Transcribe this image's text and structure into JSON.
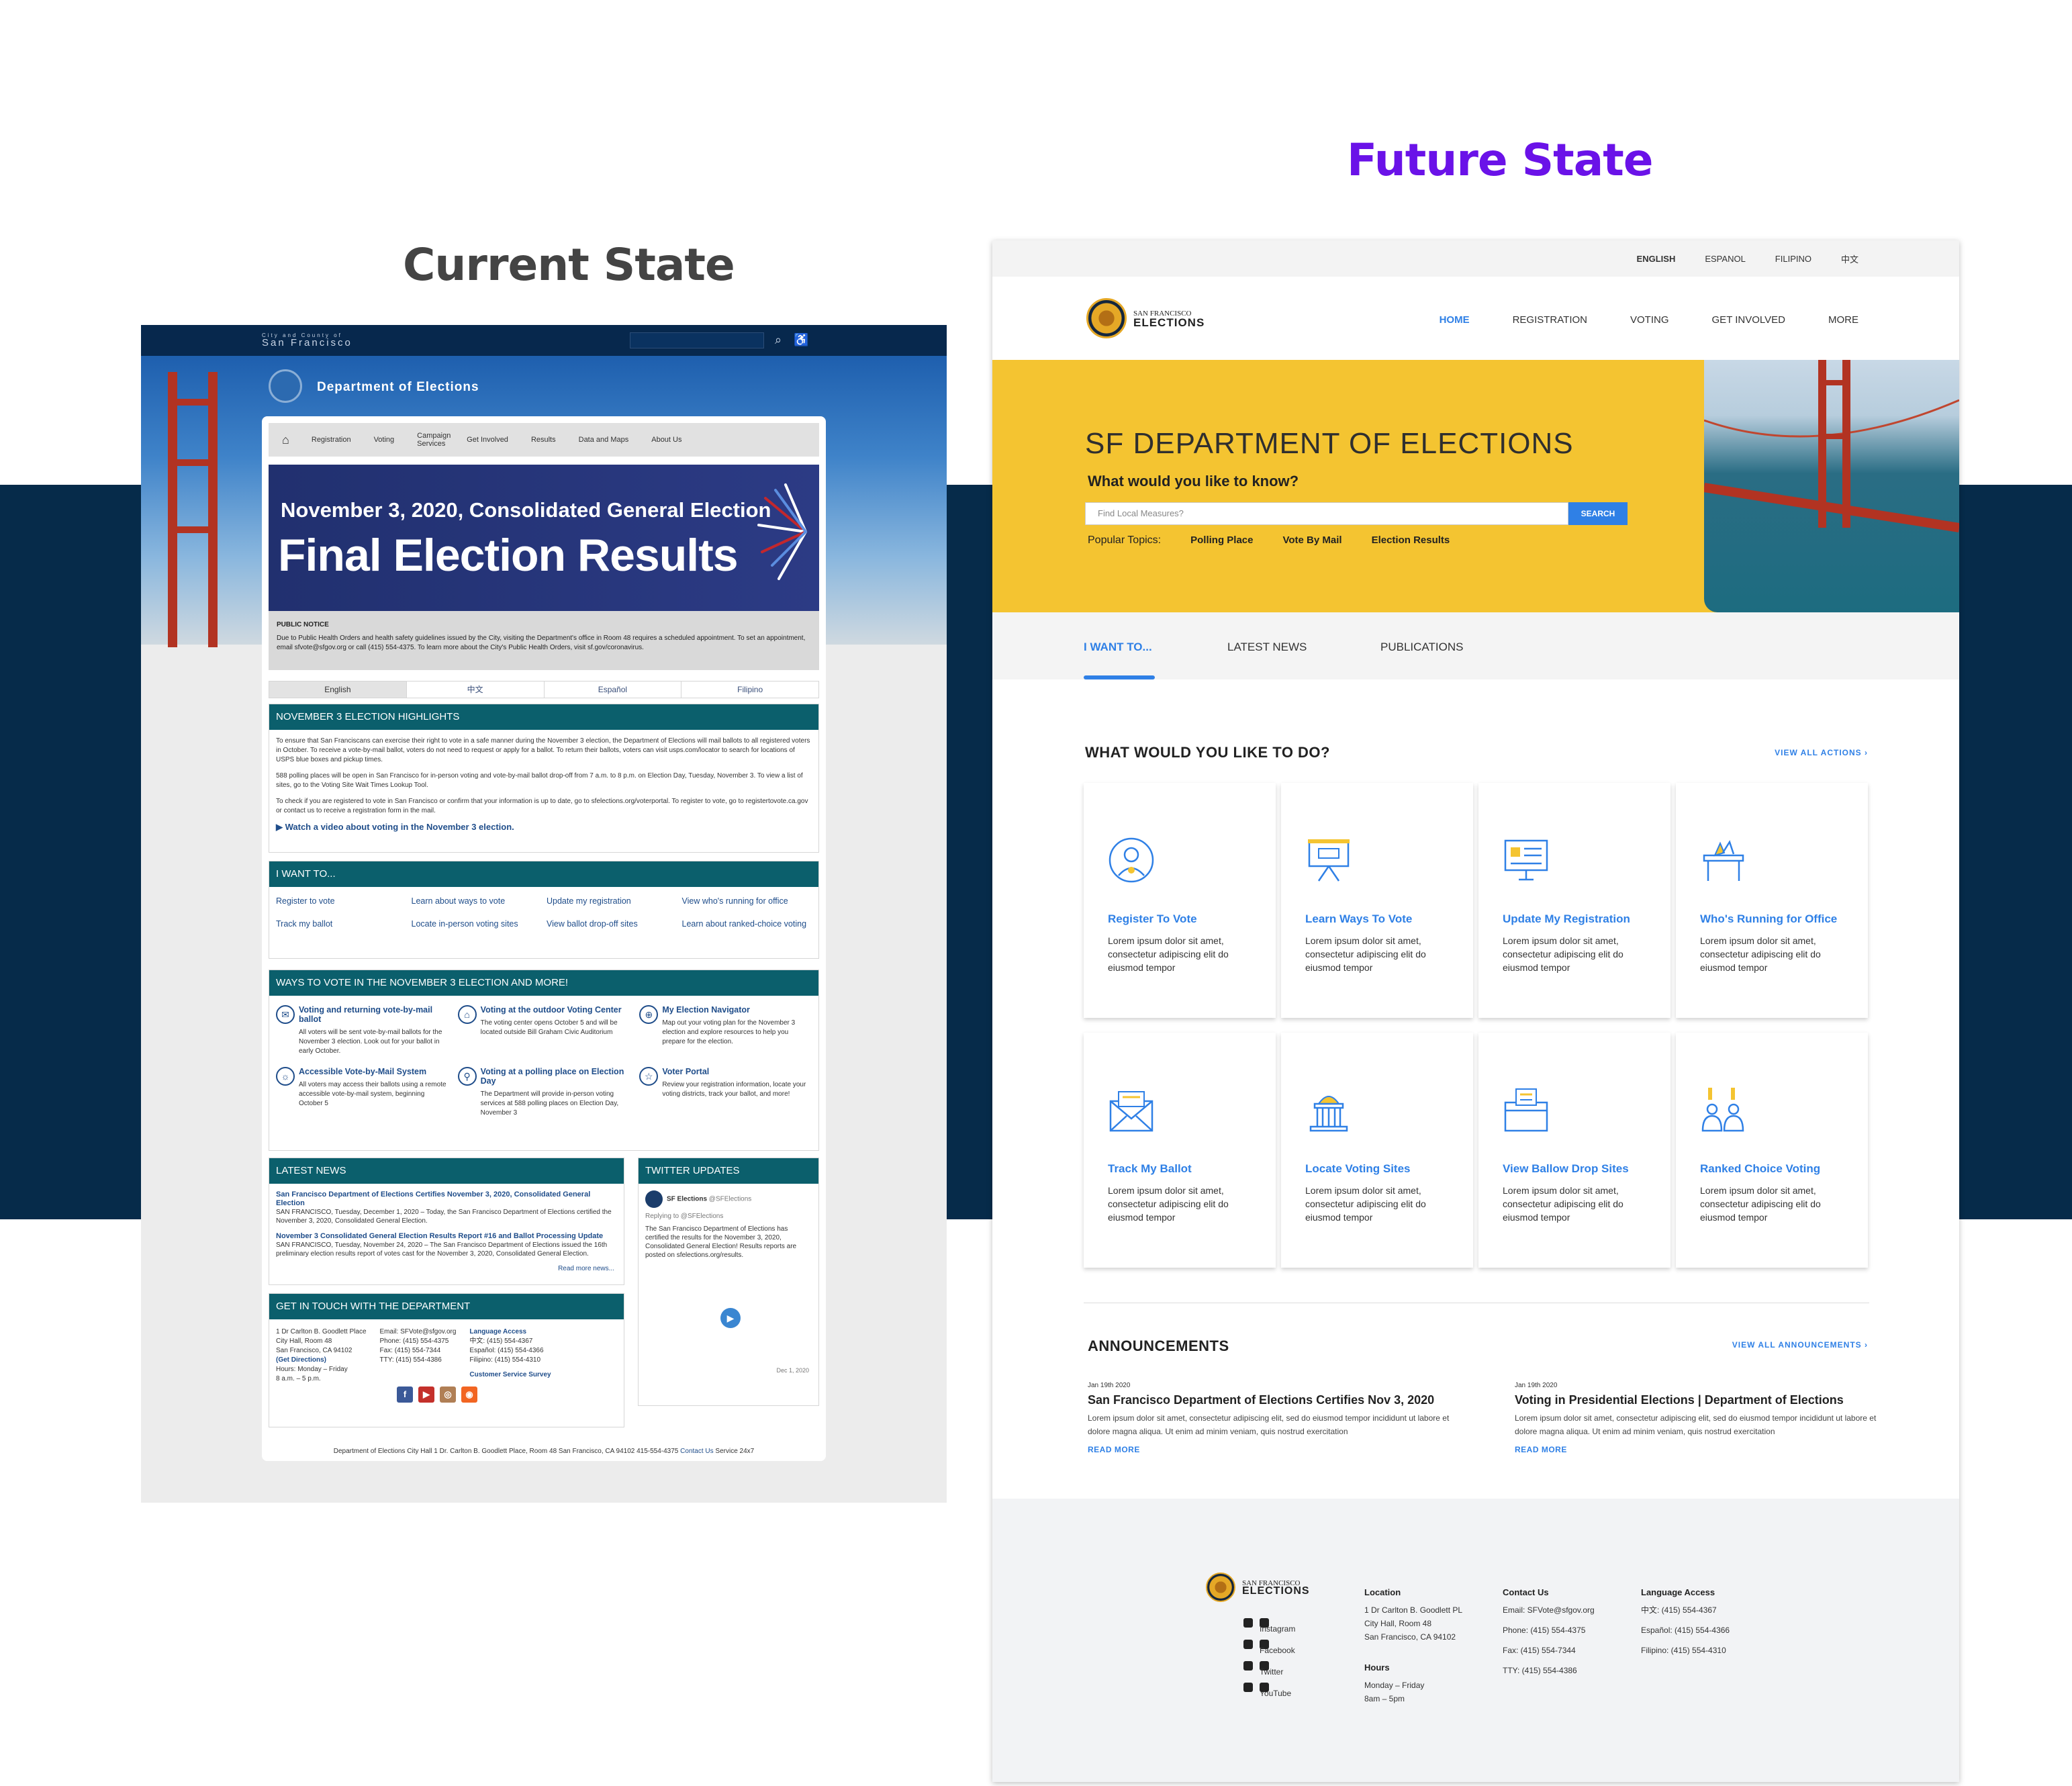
{
  "titles": {
    "current": "Current State",
    "future": "Future State"
  },
  "current": {
    "header": {
      "city_small": "City and County of",
      "city": "San Francisco",
      "dept": "Department of Elections",
      "search_icon": "search-icon",
      "access_icon": "accessibility-icon"
    },
    "nav": {
      "home_icon": "home-icon",
      "items": [
        "Registration",
        "Voting",
        "Campaign Services",
        "Get Involved",
        "Results",
        "Data and Maps",
        "About Us"
      ]
    },
    "banner": {
      "line1": "November 3, 2020, Consolidated General Election",
      "line2": "Final Election Results"
    },
    "notice": {
      "title": "PUBLIC NOTICE",
      "text": "Due to Public Health Orders and health safety guidelines issued by the City, visiting the Department's office in Room 48 requires a scheduled appointment. To set an appointment, email sfvote@sfgov.org or call (415) 554-4375. To learn more about the City's Public Health Orders, visit sf.gov/coronavirus."
    },
    "languages": [
      "English",
      "中文",
      "Español",
      "Filipino"
    ],
    "highlights": {
      "title": "NOVEMBER 3 ELECTION HIGHLIGHTS",
      "p1": "To ensure that San Franciscans can exercise their right to vote in a safe manner during the November 3 election, the Department of Elections will mail ballots to all registered voters in October. To receive a vote-by-mail ballot, voters do not need to request or apply for a ballot. To return their ballots, voters can visit usps.com/locator to search for locations of USPS blue boxes and pickup times.",
      "p2": "588 polling places will be open in San Francisco for in-person voting and vote-by-mail ballot drop-off from 7 a.m. to 8 p.m. on Election Day, Tuesday, November 3. To view a list of sites, go to the Voting Site Wait Times Lookup Tool.",
      "p3": "To check if you are registered to vote in San Francisco or confirm that your information is up to date, go to sfelections.org/voterportal. To register to vote, go to registertovote.ca.gov or contact us to receive a registration form in the mail.",
      "video": "Watch a video about voting in the November 3 election."
    },
    "iwant": {
      "title": "I WANT TO...",
      "links": [
        "Register to vote",
        "Learn about ways to vote",
        "Update my registration",
        "View who's running for office",
        "Track my ballot",
        "Locate in-person voting sites",
        "View ballot drop-off sites",
        "Learn about ranked-choice voting"
      ]
    },
    "ways": {
      "title": "WAYS TO VOTE IN THE NOVEMBER 3 ELECTION AND MORE!",
      "items": [
        {
          "t": "Voting and returning vote-by-mail ballot",
          "d": "All voters will be sent vote-by-mail ballots for the November 3 election. Look out for your ballot in early October.",
          "icon": "✉"
        },
        {
          "t": "Voting at the outdoor Voting Center",
          "d": "The voting center opens October 5 and will be located outside Bill Graham Civic Auditorium",
          "icon": "⌂"
        },
        {
          "t": "My Election Navigator",
          "d": "Map out your voting plan for the November 3 election and explore resources to help you prepare for the election.",
          "icon": "⊕"
        },
        {
          "t": "Accessible Vote-by-Mail System",
          "d": "All voters may access their ballots using a remote accessible vote-by-mail system, beginning October 5",
          "icon": "☼"
        },
        {
          "t": "Voting at a polling place on Election Day",
          "d": "The Department will provide in-person voting services at 588 polling places on Election Day, November 3",
          "icon": "⚲"
        },
        {
          "t": "Voter Portal",
          "d": "Review your registration information, locate your voting districts, track your ballot, and more!",
          "icon": "☆"
        }
      ]
    },
    "news": {
      "title": "LATEST NEWS",
      "items": [
        {
          "h": "San Francisco Department of Elections Certifies November 3, 2020, Consolidated General Election",
          "b": "SAN FRANCISCO, Tuesday, December 1, 2020 – Today, the San Francisco Department of Elections certified the November 3, 2020, Consolidated General Election."
        },
        {
          "h": "November 3 Consolidated General Election Results Report #16 and Ballot Processing Update",
          "b": "SAN FRANCISCO, Tuesday, November 24, 2020 – The San Francisco Department of Elections issued the 16th preliminary election results report of votes cast for the November 3, 2020, Consolidated General Election."
        }
      ],
      "more": "Read more news..."
    },
    "twitter": {
      "title": "TWITTER UPDATES",
      "name": "SF Elections",
      "handle": "@SFElections",
      "reply": "Replying to @SFElections",
      "text": "The San Francisco Department of Elections has certified the results for the November 3, 2020, Consolidated General Election! Results reports are posted on sfelections.org/results.",
      "date": "Dec 1, 2020"
    },
    "contact": {
      "title": "GET IN TOUCH WITH THE DEPARTMENT",
      "addr": [
        "1 Dr Carlton B. Goodlett Place",
        "City Hall, Room 48",
        "San Francisco, CA 94102",
        "(Get Directions)",
        "Hours: Monday – Friday",
        "8 a.m. – 5 p.m."
      ],
      "phones": [
        "Email: SFVote@sfgov.org",
        "Phone: (415) 554-4375",
        "Fax: (415) 554-7344",
        "TTY: (415) 554-4386"
      ],
      "lang_title": "Language Access",
      "lang": [
        "中文: (415) 554-4367",
        "Español: (415) 554-4366",
        "Filipino: (415) 554-4310"
      ],
      "survey": "Customer Service Survey"
    },
    "footer": {
      "text": "Department of Elections   City Hall   1 Dr. Carlton B. Goodlett Place, Room 48   San Francisco, CA 94102   415-554-4375",
      "contact": "Contact Us",
      "service": "Service 24x7"
    }
  },
  "future": {
    "langbar": [
      "ENGLISH",
      "ESPANOL",
      "FILIPINO",
      "中文"
    ],
    "logo": {
      "small": "SAN FRANCISCO",
      "big": "ELECTIONS"
    },
    "nav": [
      "HOME",
      "REGISTRATION",
      "VOTING",
      "GET INVOLVED",
      "MORE"
    ],
    "hero": {
      "title": "SF DEPARTMENT OF ELECTIONS",
      "question": "What would you like to know?",
      "placeholder": "Find Local Measures?",
      "button": "SEARCH",
      "popular_label": "Popular Topics:",
      "topics": [
        "Polling Place",
        "Vote By Mail",
        "Election Results"
      ]
    },
    "tabs": [
      "I WANT TO...",
      "LATEST NEWS",
      "PUBLICATIONS"
    ],
    "actions_title": "WHAT WOULD YOU LIKE TO DO?",
    "actions_link": "VIEW ALL ACTIONS  ›",
    "actions": [
      {
        "title": "Register To Vote",
        "icon": "person-check-icon"
      },
      {
        "title": "Learn Ways To Vote",
        "icon": "presentation-board-icon"
      },
      {
        "title": "Update My Registration",
        "icon": "monitor-form-icon"
      },
      {
        "title": "Who's Running for Office",
        "icon": "podium-icon"
      },
      {
        "title": "Track My Ballot",
        "icon": "envelope-icon"
      },
      {
        "title": "Locate Voting Sites",
        "icon": "capitol-building-icon"
      },
      {
        "title": "View Ballow Drop Sites",
        "icon": "ballot-box-icon"
      },
      {
        "title": "Ranked Choice Voting",
        "icon": "candidates-icon"
      }
    ],
    "lorem": "Lorem ipsum dolor sit amet, consectetur adipiscing elit do eiusmod tempor",
    "ann_title": "ANNOUNCEMENTS",
    "ann_link": "VIEW ALL ANNOUNCEMENTS  ›",
    "announcements": [
      {
        "date": "Jan 19th 2020",
        "title": "San Francisco Department of Elections Certifies Nov 3, 2020",
        "text": "Lorem ipsum dolor sit amet, consectetur adipiscing elit, sed do eiusmod tempor incididunt ut labore et dolore magna aliqua. Ut enim ad minim veniam, quis nostrud exercitation",
        "more": "READ MORE"
      },
      {
        "date": "Jan 19th 2020",
        "title": "Voting in Presidential Elections | Department of Elections",
        "text": "Lorem ipsum dolor sit amet, consectetur adipiscing elit, sed do eiusmod tempor incididunt ut labore et dolore magna aliqua. Ut enim ad minim veniam, quis nostrud exercitation",
        "more": "READ MORE"
      }
    ],
    "footer": {
      "social": [
        "Instagram",
        "Facebook",
        "Twitter",
        "YouTube"
      ],
      "location_title": "Location",
      "location": [
        "1 Dr Carlton B. Goodlett PL",
        "City Hall, Room 48",
        "San Francisco, CA 94102"
      ],
      "hours_title": "Hours",
      "hours": [
        "Monday – Friday",
        "8am – 5pm"
      ],
      "contact_title": "Contact Us",
      "contact": [
        "Email: SFVote@sfgov.org",
        "Phone: (415) 554-4375",
        "Fax: (415) 554-7344",
        "TTY: (415) 554-4386"
      ],
      "lang_title": "Language Access",
      "lang": [
        "中文: (415) 554-4367",
        "Español: (415) 554-4366",
        "Filipino: (415) 554-4310"
      ]
    }
  }
}
